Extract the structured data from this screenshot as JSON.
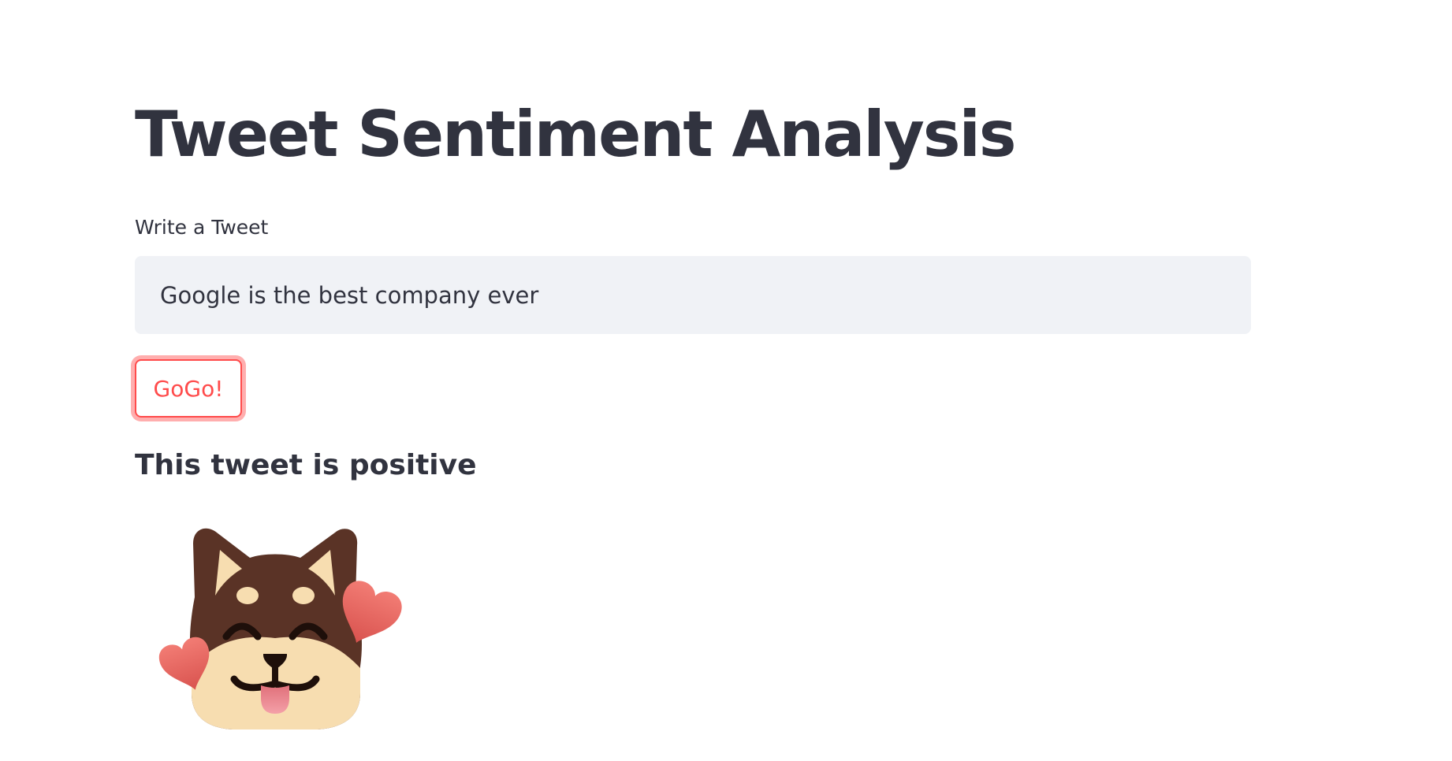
{
  "app": {
    "title": "Tweet Sentiment Analysis"
  },
  "form": {
    "input_label": "Write a Tweet",
    "input_value": "Google is the best company ever",
    "submit_label": "GoGo!"
  },
  "result": {
    "text": "This tweet is positive",
    "image_icon": "happy-shiba-with-hearts-icon"
  },
  "colors": {
    "primary": "#ff4b4b",
    "text": "#31333f",
    "input_bg": "#f0f2f6",
    "dog_brown": "#5a3326",
    "dog_cream": "#f7ddb0",
    "heart": "#e05a55",
    "tongue": "#f08f96"
  }
}
